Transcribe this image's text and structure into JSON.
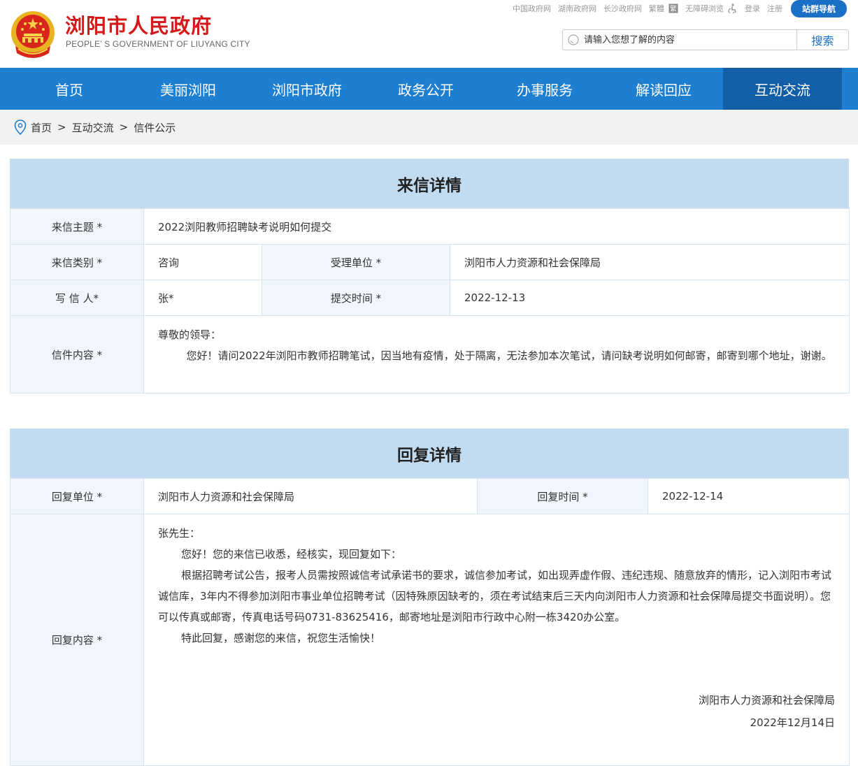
{
  "header": {
    "title": "浏阳市人民政府",
    "subtitle": "PEOPLE’ S GOVERNMENT OF LIUYANG CITY",
    "links": [
      "中国政府网",
      "湖南政府网",
      "长沙政府网",
      "繁體",
      "无障碍浏览",
      "登录",
      "注册"
    ],
    "nav_button": "站群导航",
    "search_placeholder": "请输入您想了解的内容",
    "search_button": "搜索"
  },
  "nav": [
    "首页",
    "美丽浏阳",
    "浏阳市政府",
    "政务公开",
    "办事服务",
    "解读回应",
    "互动交流"
  ],
  "breadcrumb": {
    "home": "首页",
    "sep": ">",
    "level1": "互动交流",
    "level2": "信件公示"
  },
  "letter": {
    "heading": "来信详情",
    "subject_label": "来信主题 *",
    "subject": "2022浏阳教师招聘缺考说明如何提交",
    "category_label": "来信类别 *",
    "category": "咨询",
    "unit_label": "受理单位 *",
    "unit": "浏阳市人力资源和社会保障局",
    "writer_label": "写 信 人*",
    "writer": "张*",
    "time_label": "提交时间 *",
    "time": "2022-12-13",
    "content_label": "信件内容 *",
    "greeting": "尊敬的领导：",
    "body": "您好！请问2022年浏阳市教师招聘笔试，因当地有疫情，处于隔离，无法参加本次笔试，请问缺考说明如何邮寄，邮寄到哪个地址，谢谢。"
  },
  "reply": {
    "heading": "回复详情",
    "unit_label": "回复单位 *",
    "unit": "浏阳市人力资源和社会保障局",
    "time_label": "回复时间 *",
    "time": "2022-12-14",
    "content_label": "回复内容 *",
    "greeting": "张先生：",
    "p1": "您好！您的来信已收悉，经核实，现回复如下：",
    "p2": "根据招聘考试公告，报考人员需按照诚信考试承诺书的要求，诚信参加考试，如出现弄虚作假、违纪违规、随意放弃的情形，记入浏阳市考试诚信库，3年内不得参加浏阳市事业单位招聘考试（因特殊原因缺考的，须在考试结束后三天内向浏阳市人力资源和社会保障局提交书面说明）。您可以传真或邮寄，传真电话号码0731-83625416，邮寄地址是浏阳市行政中心附一栋3420办公室。",
    "p3": "特此回复，感谢您的来信，祝您生活愉快！",
    "sign_org": "浏阳市人力资源和社会保障局",
    "sign_date": "2022年12月14日"
  },
  "colors": {
    "brand_red": "#d41a1a",
    "nav_blue": "#1e7fd0",
    "nav_active": "#125fa7",
    "panel_head": "#c1dbf0"
  }
}
